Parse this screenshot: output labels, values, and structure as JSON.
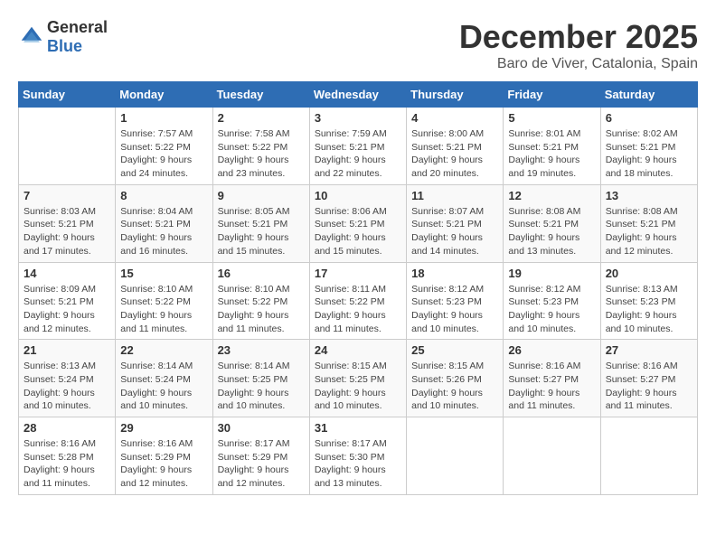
{
  "header": {
    "logo_general": "General",
    "logo_blue": "Blue",
    "month_title": "December 2025",
    "location": "Baro de Viver, Catalonia, Spain"
  },
  "days_of_week": [
    "Sunday",
    "Monday",
    "Tuesday",
    "Wednesday",
    "Thursday",
    "Friday",
    "Saturday"
  ],
  "weeks": [
    [
      {
        "day": "",
        "info": ""
      },
      {
        "day": "1",
        "info": "Sunrise: 7:57 AM\nSunset: 5:22 PM\nDaylight: 9 hours\nand 24 minutes."
      },
      {
        "day": "2",
        "info": "Sunrise: 7:58 AM\nSunset: 5:22 PM\nDaylight: 9 hours\nand 23 minutes."
      },
      {
        "day": "3",
        "info": "Sunrise: 7:59 AM\nSunset: 5:21 PM\nDaylight: 9 hours\nand 22 minutes."
      },
      {
        "day": "4",
        "info": "Sunrise: 8:00 AM\nSunset: 5:21 PM\nDaylight: 9 hours\nand 20 minutes."
      },
      {
        "day": "5",
        "info": "Sunrise: 8:01 AM\nSunset: 5:21 PM\nDaylight: 9 hours\nand 19 minutes."
      },
      {
        "day": "6",
        "info": "Sunrise: 8:02 AM\nSunset: 5:21 PM\nDaylight: 9 hours\nand 18 minutes."
      }
    ],
    [
      {
        "day": "7",
        "info": "Sunrise: 8:03 AM\nSunset: 5:21 PM\nDaylight: 9 hours\nand 17 minutes."
      },
      {
        "day": "8",
        "info": "Sunrise: 8:04 AM\nSunset: 5:21 PM\nDaylight: 9 hours\nand 16 minutes."
      },
      {
        "day": "9",
        "info": "Sunrise: 8:05 AM\nSunset: 5:21 PM\nDaylight: 9 hours\nand 15 minutes."
      },
      {
        "day": "10",
        "info": "Sunrise: 8:06 AM\nSunset: 5:21 PM\nDaylight: 9 hours\nand 15 minutes."
      },
      {
        "day": "11",
        "info": "Sunrise: 8:07 AM\nSunset: 5:21 PM\nDaylight: 9 hours\nand 14 minutes."
      },
      {
        "day": "12",
        "info": "Sunrise: 8:08 AM\nSunset: 5:21 PM\nDaylight: 9 hours\nand 13 minutes."
      },
      {
        "day": "13",
        "info": "Sunrise: 8:08 AM\nSunset: 5:21 PM\nDaylight: 9 hours\nand 12 minutes."
      }
    ],
    [
      {
        "day": "14",
        "info": "Sunrise: 8:09 AM\nSunset: 5:21 PM\nDaylight: 9 hours\nand 12 minutes."
      },
      {
        "day": "15",
        "info": "Sunrise: 8:10 AM\nSunset: 5:22 PM\nDaylight: 9 hours\nand 11 minutes."
      },
      {
        "day": "16",
        "info": "Sunrise: 8:10 AM\nSunset: 5:22 PM\nDaylight: 9 hours\nand 11 minutes."
      },
      {
        "day": "17",
        "info": "Sunrise: 8:11 AM\nSunset: 5:22 PM\nDaylight: 9 hours\nand 11 minutes."
      },
      {
        "day": "18",
        "info": "Sunrise: 8:12 AM\nSunset: 5:23 PM\nDaylight: 9 hours\nand 10 minutes."
      },
      {
        "day": "19",
        "info": "Sunrise: 8:12 AM\nSunset: 5:23 PM\nDaylight: 9 hours\nand 10 minutes."
      },
      {
        "day": "20",
        "info": "Sunrise: 8:13 AM\nSunset: 5:23 PM\nDaylight: 9 hours\nand 10 minutes."
      }
    ],
    [
      {
        "day": "21",
        "info": "Sunrise: 8:13 AM\nSunset: 5:24 PM\nDaylight: 9 hours\nand 10 minutes."
      },
      {
        "day": "22",
        "info": "Sunrise: 8:14 AM\nSunset: 5:24 PM\nDaylight: 9 hours\nand 10 minutes."
      },
      {
        "day": "23",
        "info": "Sunrise: 8:14 AM\nSunset: 5:25 PM\nDaylight: 9 hours\nand 10 minutes."
      },
      {
        "day": "24",
        "info": "Sunrise: 8:15 AM\nSunset: 5:25 PM\nDaylight: 9 hours\nand 10 minutes."
      },
      {
        "day": "25",
        "info": "Sunrise: 8:15 AM\nSunset: 5:26 PM\nDaylight: 9 hours\nand 10 minutes."
      },
      {
        "day": "26",
        "info": "Sunrise: 8:16 AM\nSunset: 5:27 PM\nDaylight: 9 hours\nand 11 minutes."
      },
      {
        "day": "27",
        "info": "Sunrise: 8:16 AM\nSunset: 5:27 PM\nDaylight: 9 hours\nand 11 minutes."
      }
    ],
    [
      {
        "day": "28",
        "info": "Sunrise: 8:16 AM\nSunset: 5:28 PM\nDaylight: 9 hours\nand 11 minutes."
      },
      {
        "day": "29",
        "info": "Sunrise: 8:16 AM\nSunset: 5:29 PM\nDaylight: 9 hours\nand 12 minutes."
      },
      {
        "day": "30",
        "info": "Sunrise: 8:17 AM\nSunset: 5:29 PM\nDaylight: 9 hours\nand 12 minutes."
      },
      {
        "day": "31",
        "info": "Sunrise: 8:17 AM\nSunset: 5:30 PM\nDaylight: 9 hours\nand 13 minutes."
      },
      {
        "day": "",
        "info": ""
      },
      {
        "day": "",
        "info": ""
      },
      {
        "day": "",
        "info": ""
      }
    ]
  ]
}
